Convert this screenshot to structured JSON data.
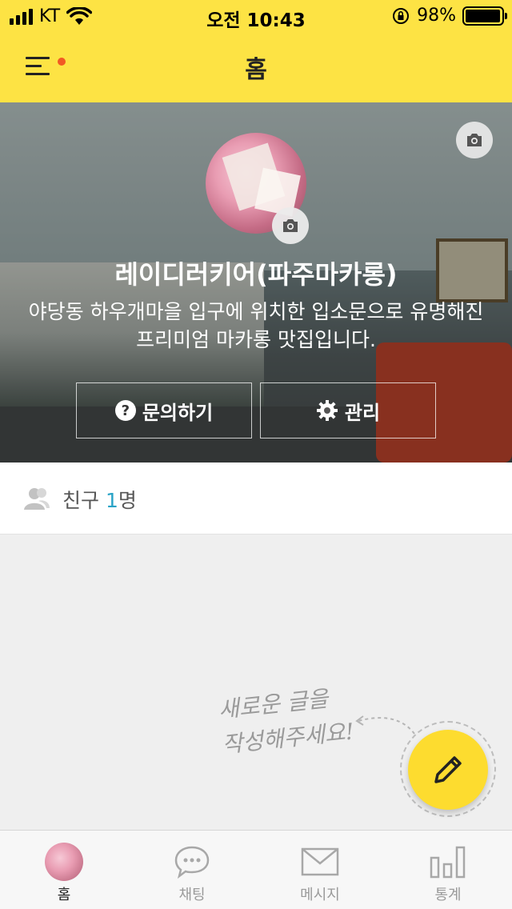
{
  "status_bar": {
    "carrier": "KT",
    "time": "오전 10:43",
    "battery": "98%",
    "battery_level": 0.98
  },
  "header": {
    "title": "홈",
    "menu_icon": "hamburger-icon",
    "notification_dot_color": "#f15a24"
  },
  "profile": {
    "name": "레이디러키어(파주마카롱)",
    "description": "야당동 하우개마을 입구에 위치한 입소문으로 유명해진 프리미엄 마카롱 맛집입니다.",
    "inquiry_label": "문의하기",
    "manage_label": "관리",
    "inquiry_icon": "question-icon",
    "manage_icon": "gear-icon",
    "cover_camera_icon": "camera-icon",
    "avatar_camera_icon": "camera-icon"
  },
  "friends": {
    "label": "친구",
    "count": "1",
    "unit": "명",
    "icon": "person-icon"
  },
  "feed": {
    "hint_line1": "새로운 글을",
    "hint_line2": "작성해주세요!",
    "fab_icon": "pencil-icon"
  },
  "tabs": [
    {
      "label": "홈",
      "icon": "avatar",
      "active": true
    },
    {
      "label": "채팅",
      "icon": "chat-bubble-icon",
      "active": false
    },
    {
      "label": "메시지",
      "icon": "envelope-icon",
      "active": false
    },
    {
      "label": "통계",
      "icon": "bar-chart-icon",
      "active": false
    }
  ],
  "colors": {
    "header_bg": "#fde344",
    "fab_bg": "#fddc2f",
    "accent_count": "#29a3c6"
  }
}
